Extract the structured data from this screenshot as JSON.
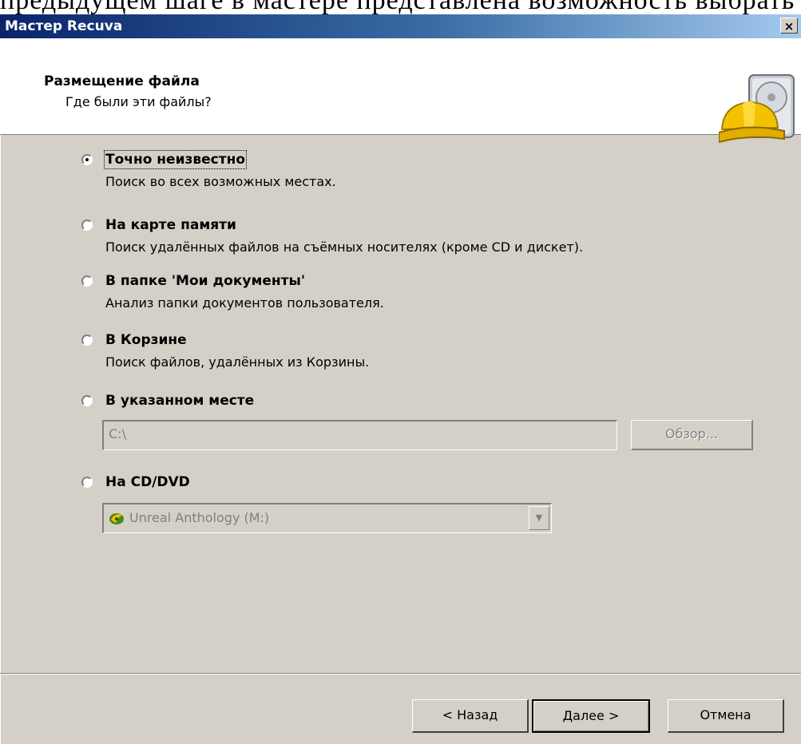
{
  "background_text": "предыдущем шаге в мастере представлена возможность выбрать какой тип файлов",
  "window": {
    "title": "Мастер Recuva",
    "close_label": "×"
  },
  "header": {
    "title": "Размещение файла",
    "subtitle": "Где были эти файлы?",
    "logo_icon": "recuva-hardhat-drive-icon"
  },
  "options": [
    {
      "label": "Точно неизвестно",
      "desc": "Поиск во всех возможных местах.",
      "checked": true
    },
    {
      "label": "На карте памяти",
      "desc": "Поиск удалённых файлов на съёмных носителях (кроме CD и дискет).",
      "checked": false
    },
    {
      "label": "В папке 'Мои документы'",
      "desc": "Анализ папки документов пользователя.",
      "checked": false
    },
    {
      "label": "В Корзине",
      "desc": "Поиск файлов, удалённых из Корзины.",
      "checked": false
    },
    {
      "label": "В указанном месте",
      "desc": "",
      "checked": false
    },
    {
      "label": "На CD/DVD",
      "desc": "",
      "checked": false
    }
  ],
  "path_input": {
    "value": "C:\\"
  },
  "browse_button": "Обзор...",
  "drive_select": {
    "value": "Unreal Anthology (M:)",
    "icon": "cd-drive-icon"
  },
  "buttons": {
    "back": "< Назад",
    "next": "Далее >",
    "cancel": "Отмена"
  },
  "colors": {
    "dialog_bg": "#d4d0c8",
    "title_gradient_start": "#0a246a",
    "title_gradient_end": "#a6caf0",
    "disabled_text": "#808080"
  }
}
